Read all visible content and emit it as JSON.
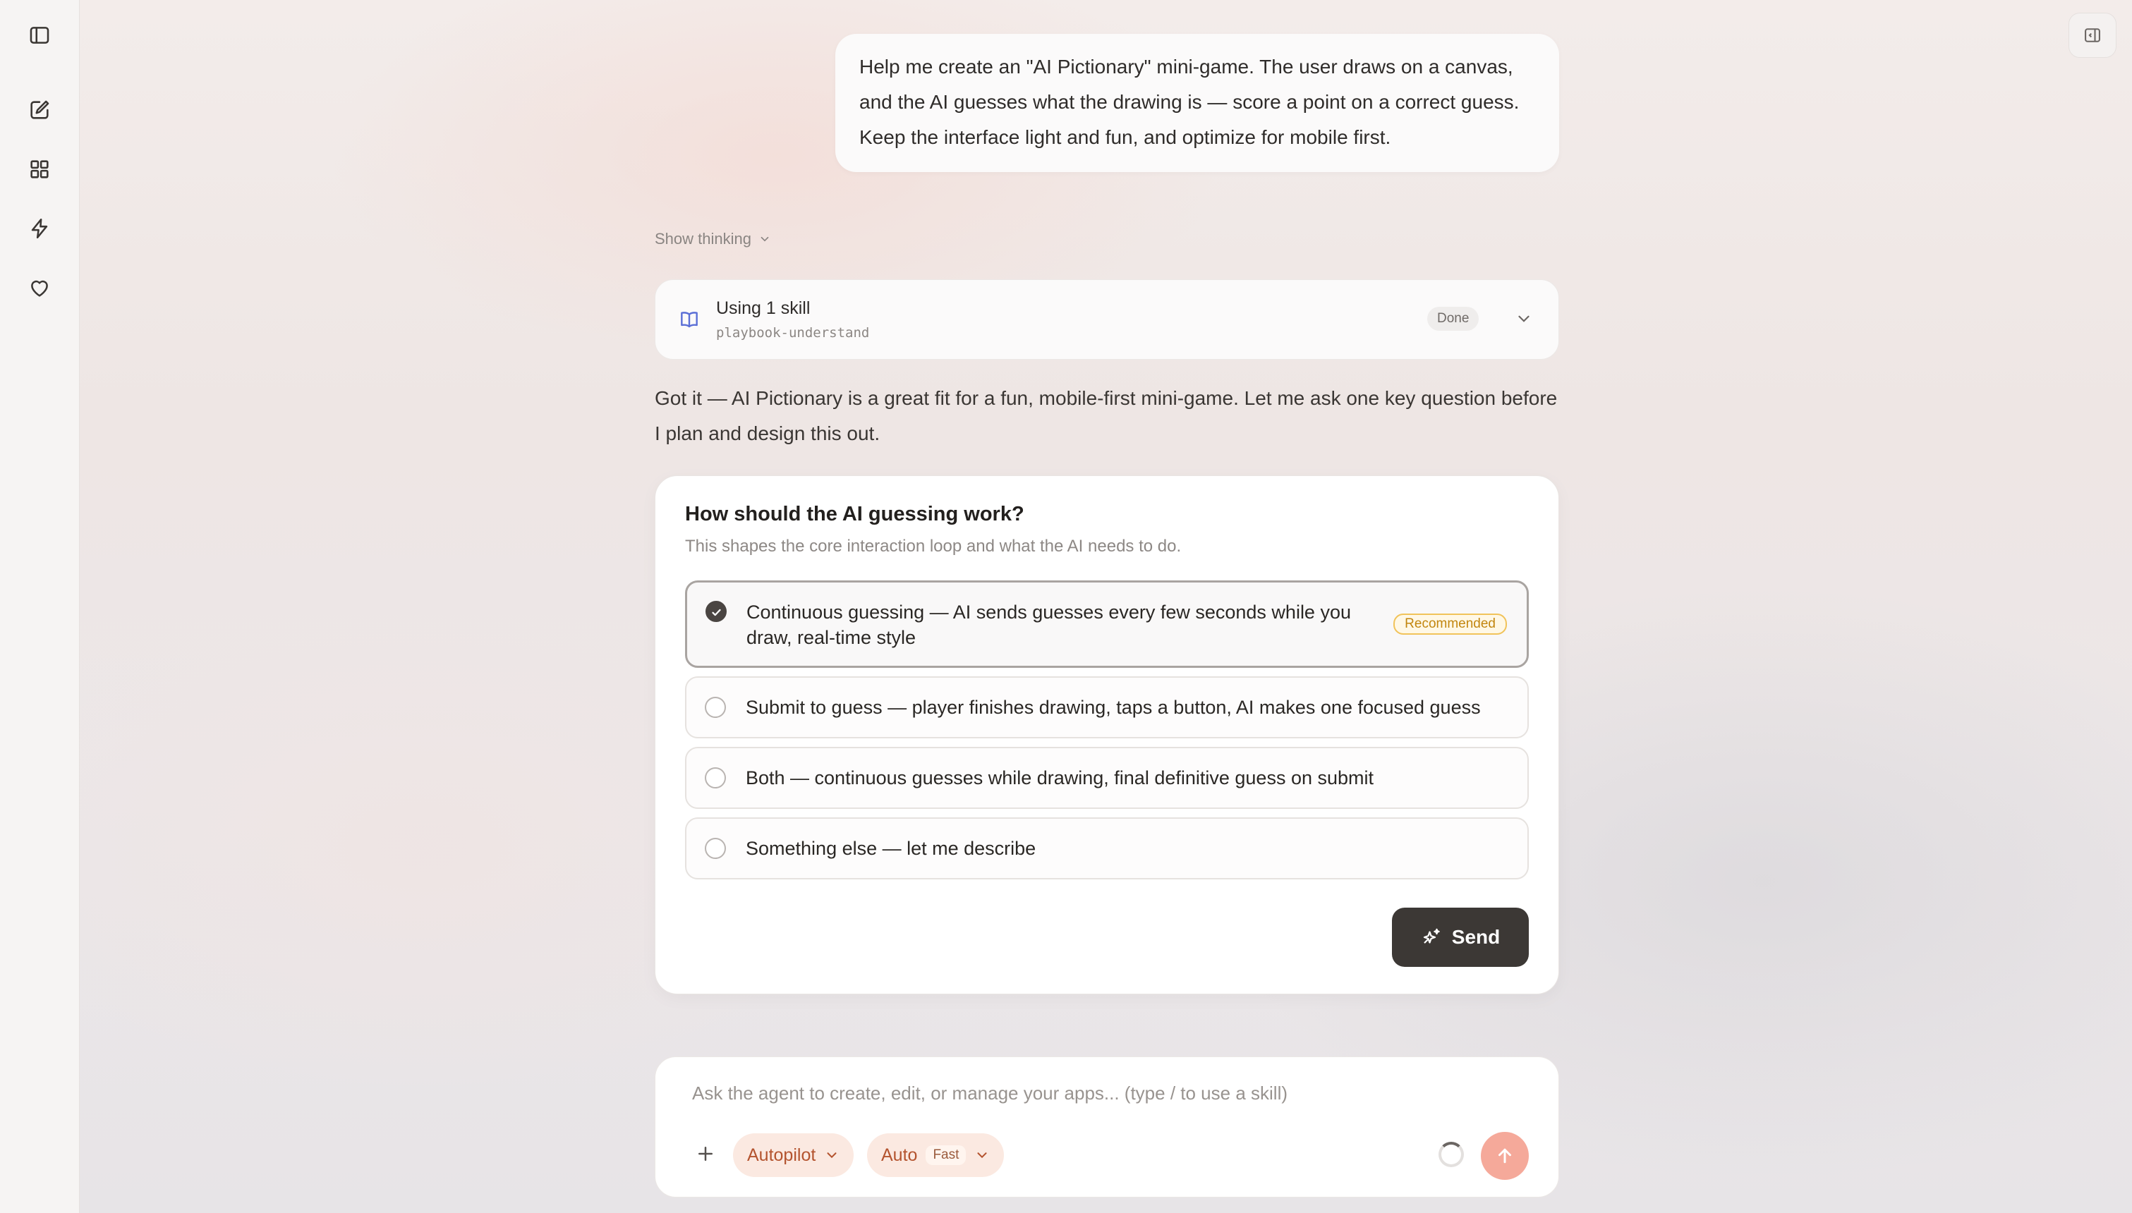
{
  "sidebar": {
    "items": [
      {
        "icon": "sidebar-toggle-icon"
      },
      {
        "icon": "new-chat-icon"
      },
      {
        "icon": "apps-grid-icon"
      },
      {
        "icon": "lightning-icon"
      },
      {
        "icon": "heart-icon"
      }
    ]
  },
  "topbar": {
    "right_icon": "panel-toggle-icon"
  },
  "conversation": {
    "user_message": "Help me create an \"AI Pictionary\" mini-game. The user draws on a canvas, and the AI guesses what the drawing is — score a point on a correct guess. Keep the interface light and fun, and optimize for mobile first.",
    "show_thinking_label": "Show thinking",
    "skill": {
      "title": "Using 1 skill",
      "name": "playbook-understand",
      "status": "Done"
    },
    "assistant_reply": "Got it — AI Pictionary is a great fit for a fun, mobile-first mini-game. Let me ask one key question before I plan and design this out."
  },
  "question": {
    "title": "How should the AI guessing work?",
    "subtitle": "This shapes the core interaction loop and what the AI needs to do.",
    "options": [
      {
        "label": "Continuous guessing — AI sends guesses every few seconds while you draw, real-time style",
        "selected": true,
        "badge": "Recommended"
      },
      {
        "label": "Submit to guess — player finishes drawing, taps a button, AI makes one focused guess",
        "selected": false
      },
      {
        "label": "Both — continuous guesses while drawing, final definitive guess on submit",
        "selected": false
      },
      {
        "label": "Something else — let me describe",
        "selected": false
      }
    ],
    "send_label": "Send"
  },
  "composer": {
    "placeholder": "Ask the agent to create, edit, or manage your apps... (type / to use a skill)",
    "value": "",
    "mode_label": "Autopilot",
    "model_label": "Auto",
    "model_tag": "Fast"
  },
  "colors": {
    "accent": "#b4542f",
    "accent_bg": "#fbe9e1",
    "send_button": "#3c3835",
    "submit_button": "#f5a99a",
    "recommended_border": "#f1c35a"
  }
}
